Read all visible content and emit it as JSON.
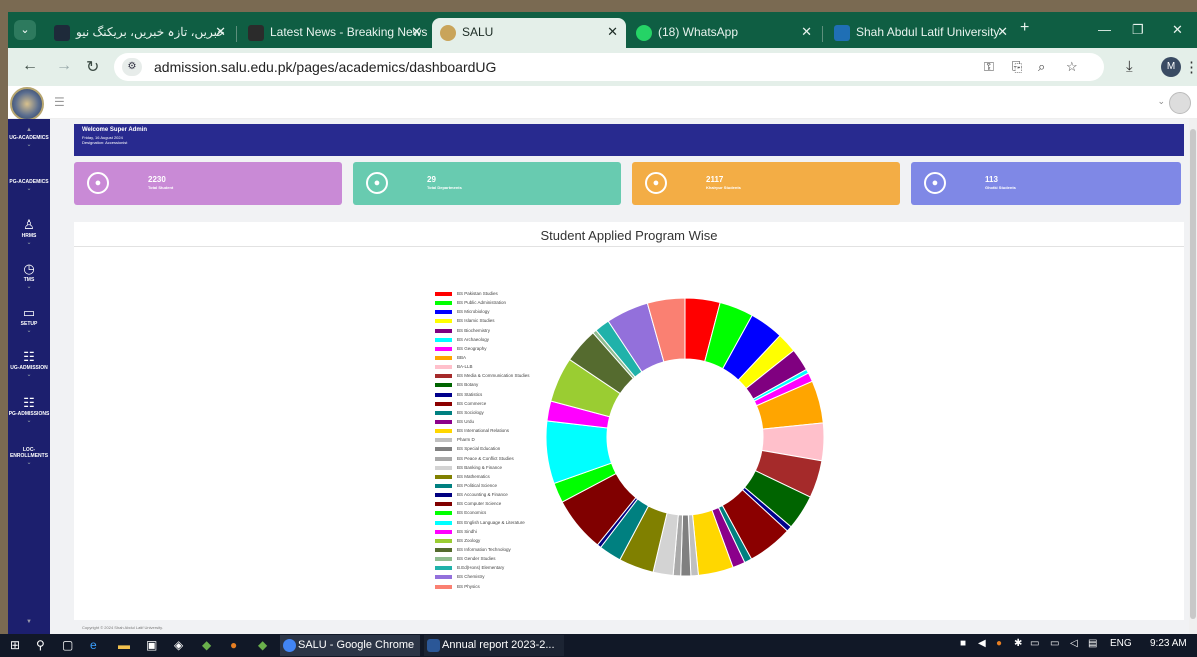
{
  "browser": {
    "tabs": [
      {
        "title": "خبریں، تازہ خبریں، بریکنگ نیو",
        "favicon_color": "#1e2a3a",
        "active": false
      },
      {
        "title": "Latest News - Breaking News",
        "favicon_color": "#2b2b2b",
        "active": false
      },
      {
        "title": "SALU",
        "favicon_color": "#c9a45a",
        "active": true
      },
      {
        "title": "(18) WhatsApp",
        "favicon_color": "#25d366",
        "active": false
      },
      {
        "title": "Shah Abdul Latif University",
        "favicon_color": "#1f6fb5",
        "active": false
      }
    ],
    "url": "admission.salu.edu.pk/pages/academics/dashboardUG",
    "profile_initial": "M"
  },
  "sidebar": {
    "items": [
      {
        "icon": "graduation-icon",
        "label": "UG-ACADEMICS"
      },
      {
        "icon": "graduation-icon",
        "label": "PG-ACADEMICS"
      },
      {
        "icon": "user-icon",
        "label": "HRMS"
      },
      {
        "icon": "clock-icon",
        "label": "TMS"
      },
      {
        "icon": "monitor-icon",
        "label": "SETUP"
      },
      {
        "icon": "sitemap-icon",
        "label": "UG-ADMISSION"
      },
      {
        "icon": "sitemap-icon",
        "label": "PG-ADMISSIONS"
      },
      {
        "icon": "list-icon",
        "label": "LOC-ENROLLMENTS"
      }
    ]
  },
  "welcome": {
    "title": "Welcome Super Admin",
    "date": "Friday, 16 August 2024",
    "designation": "Designation: Accessionist"
  },
  "stats": [
    {
      "value": "2230",
      "label": "Total Student",
      "color": "#c98ad6"
    },
    {
      "value": "29",
      "label": "Total Departments",
      "color": "#68cbb0"
    },
    {
      "value": "2117",
      "label": "Khairpur Students",
      "color": "#f3ad45"
    },
    {
      "value": "113",
      "label": "Ghotki Students",
      "color": "#7f88e6"
    }
  ],
  "chart_data": {
    "type": "pie",
    "title": "Student Applied Program Wise",
    "donut": true,
    "series": [
      {
        "name": "BS Pakistan Studies",
        "value": 70,
        "color": "#ff0000"
      },
      {
        "name": "BS Public Administration",
        "value": 68,
        "color": "#00ff00"
      },
      {
        "name": "BS Microbiology",
        "value": 68,
        "color": "#0000ff"
      },
      {
        "name": "BS Islamic Studies",
        "value": 40,
        "color": "#ffff00"
      },
      {
        "name": "BS Biochemistry",
        "value": 45,
        "color": "#800080"
      },
      {
        "name": "BS Archaeology",
        "value": 8,
        "color": "#00ffff"
      },
      {
        "name": "BS Geography",
        "value": 18,
        "color": "#ff00ff"
      },
      {
        "name": "BBA",
        "value": 85,
        "color": "#ffa500"
      },
      {
        "name": "BA-LLB",
        "value": 75,
        "color": "#ffc0cb"
      },
      {
        "name": "BS Media & Communication Studies",
        "value": 75,
        "color": "#a52a2a"
      },
      {
        "name": "BS Botany",
        "value": 70,
        "color": "#006400"
      },
      {
        "name": "BS Statistics",
        "value": 11,
        "color": "#00008b"
      },
      {
        "name": "BS Commerce",
        "value": 90,
        "color": "#8b0000"
      },
      {
        "name": "BS Sociology",
        "value": 15,
        "color": "#008080"
      },
      {
        "name": "BS Urdu",
        "value": 25,
        "color": "#8b008b"
      },
      {
        "name": "BS International Relations",
        "value": 70,
        "color": "#ffd700"
      },
      {
        "name": "Pharm D",
        "value": 15,
        "color": "#c0c0c0"
      },
      {
        "name": "BS Special Education",
        "value": 20,
        "color": "#808080"
      },
      {
        "name": "BS Peace & Conflict Studies",
        "value": 15,
        "color": "#a9a9a9"
      },
      {
        "name": "BS Banking & Finance",
        "value": 40,
        "color": "#d3d3d3"
      },
      {
        "name": "BS Mathematics",
        "value": 70,
        "color": "#808000"
      },
      {
        "name": "BS Political Science",
        "value": 45,
        "color": "#008080"
      },
      {
        "name": "BS Accounting & Finance",
        "value": 8,
        "color": "#000080"
      },
      {
        "name": "BS Computer Science",
        "value": 110,
        "color": "#800000"
      },
      {
        "name": "BS Economics",
        "value": 40,
        "color": "#00ff00"
      },
      {
        "name": "BS English Language & Literature",
        "value": 125,
        "color": "#00ffff"
      },
      {
        "name": "BS Sindhi",
        "value": 40,
        "color": "#ff00ff"
      },
      {
        "name": "BS Zoology",
        "value": 90,
        "color": "#9acd32"
      },
      {
        "name": "BS Information Technology",
        "value": 70,
        "color": "#556b2f"
      },
      {
        "name": "BS Gender Studies",
        "value": 8,
        "color": "#8fbc8f"
      },
      {
        "name": "B.Ed(Hons) Elementary",
        "value": 30,
        "color": "#20b2aa"
      },
      {
        "name": "BS Chemistry",
        "value": 85,
        "color": "#9370db"
      },
      {
        "name": "BS Physics",
        "value": 75,
        "color": "#fa8072"
      }
    ]
  },
  "footer": {
    "copyright": "Copyright © 2024 Shah Abdul Latif University."
  },
  "taskbar": {
    "apps": [
      {
        "label": "SALU - Google Chrome",
        "color": "#4285f4"
      },
      {
        "label": "Annual report 2023-2...",
        "color": "#2b5797"
      }
    ],
    "lang": "ENG",
    "time": "9:23 AM"
  }
}
